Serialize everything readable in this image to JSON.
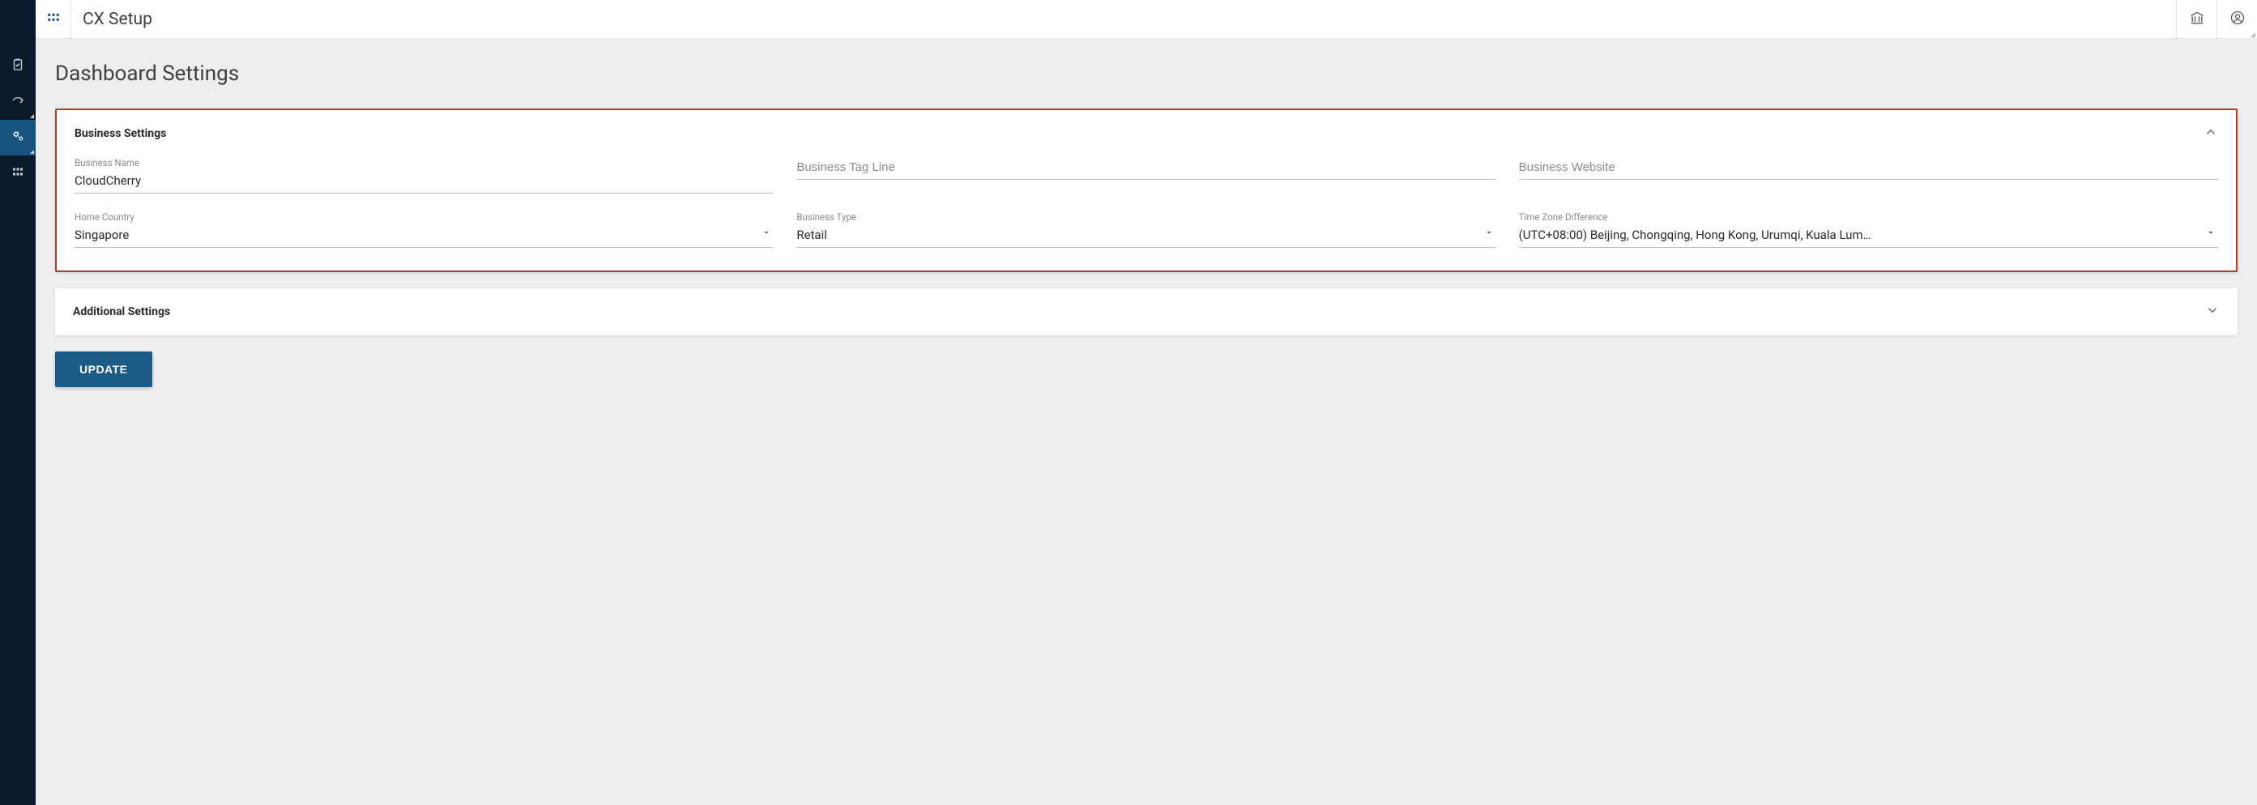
{
  "header": {
    "title": "CX Setup"
  },
  "page": {
    "section_title": "Dashboard Settings"
  },
  "business_settings": {
    "panel_title": "Business Settings",
    "fields": {
      "business_name": {
        "label": "Business Name",
        "value": "CloudCherry"
      },
      "tag_line": {
        "placeholder": "Business Tag Line",
        "value": ""
      },
      "website": {
        "placeholder": "Business Website",
        "value": ""
      },
      "home_country": {
        "label": "Home Country",
        "value": "Singapore"
      },
      "business_type": {
        "label": "Business Type",
        "value": "Retail"
      },
      "timezone": {
        "label": "Time Zone Difference",
        "value": "(UTC+08:00) Beijing, Chongqing, Hong Kong, Urumqi, Kuala Lum…"
      }
    }
  },
  "additional_settings": {
    "panel_title": "Additional Settings"
  },
  "actions": {
    "update_label": "UPDATE"
  }
}
